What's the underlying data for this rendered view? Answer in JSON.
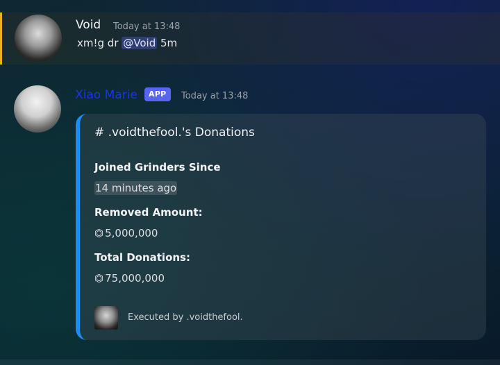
{
  "messages": [
    {
      "author": "Void",
      "timestamp": "Today at 13:48",
      "content_before": "xm!g dr ",
      "mention": "@Void",
      "content_after": " 5m"
    },
    {
      "author": "Xiao Marie",
      "badge": "APP",
      "timestamp": "Today at 13:48",
      "embed": {
        "title": "# .voidthefool.'s Donations",
        "accent_color": "#1e8df2",
        "fields": [
          {
            "name": "Joined Grinders Since",
            "value": "14 minutes ago"
          },
          {
            "name": "Removed Amount:",
            "value": "5,000,000",
            "icon": "coin-icon"
          },
          {
            "name": "Total Donations:",
            "value": "75,000,000",
            "icon": "coin-icon"
          }
        ],
        "footer": "Executed by .voidthefool."
      }
    }
  ],
  "colors": {
    "mention_highlight_bar": "#e6b21e",
    "marie_name": "#1a33e8",
    "app_badge": "#5865f2"
  }
}
